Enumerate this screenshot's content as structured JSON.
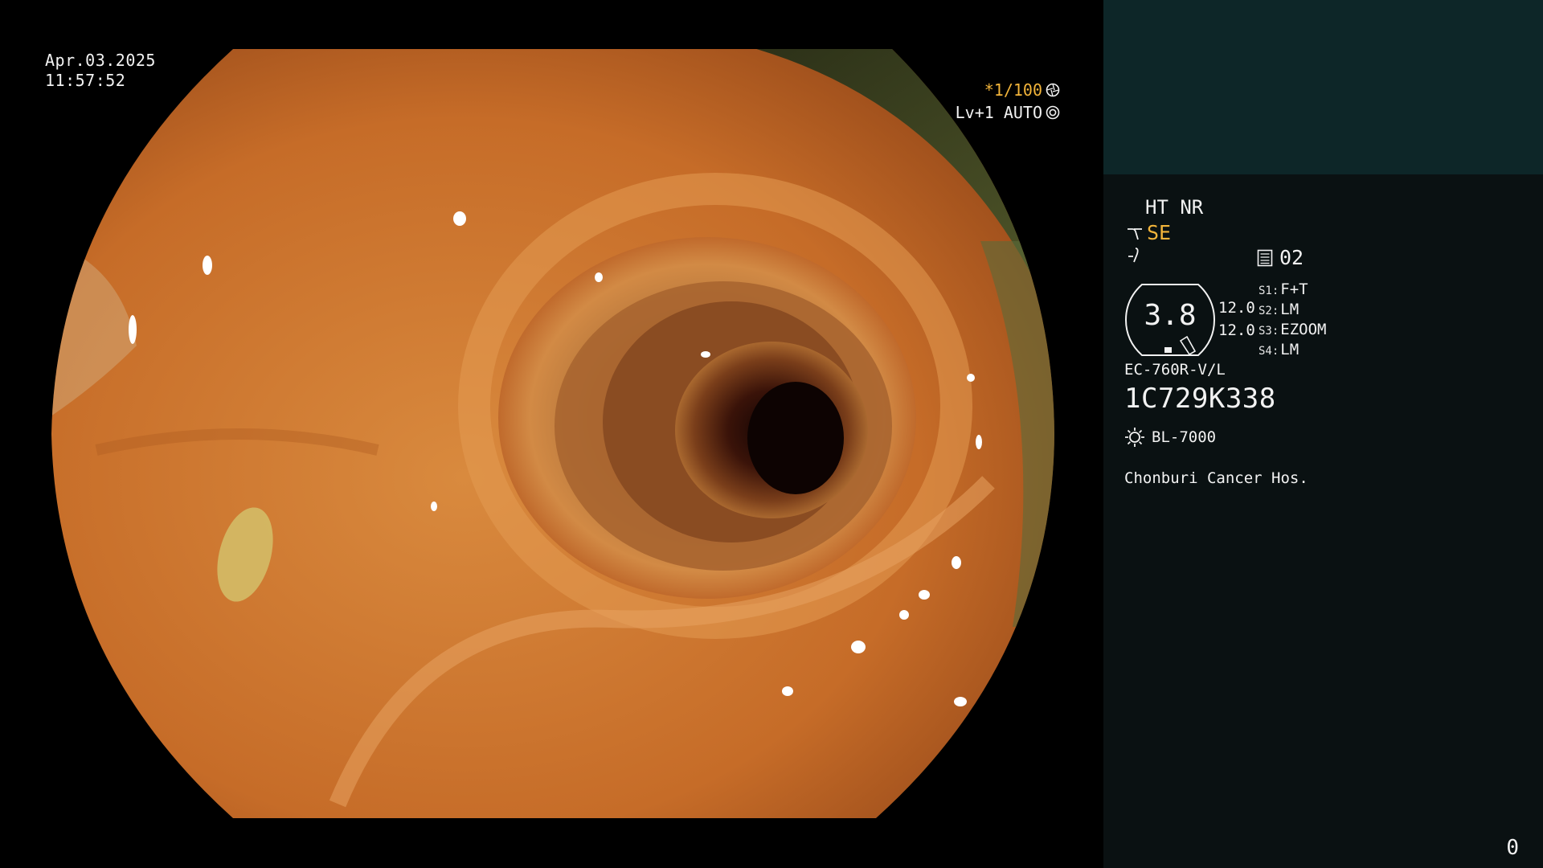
{
  "overlay": {
    "date": "Apr.03.2025",
    "time": "11:57:52",
    "shutter": "*1/100",
    "shutter_icon": "shutter-icon",
    "exposure": "Lv+1 AUTO",
    "exposure_icon": "iris-icon"
  },
  "panel": {
    "ht_nr": "HT NR",
    "structure_enhancement": "SE",
    "memory_label": "02",
    "gauge_value": "3.8",
    "iris_values": [
      "12.0",
      "12.0"
    ],
    "switches": [
      {
        "key": "S1:",
        "value": "F+T"
      },
      {
        "key": "S2:",
        "value": "LM"
      },
      {
        "key": "S3:",
        "value": "EZOOM"
      },
      {
        "key": "S4:",
        "value": "LM"
      }
    ],
    "scope_model": "EC-760R-V/L",
    "scope_serial": "1C729K338",
    "light_source": "BL-7000",
    "hospital": "Chonburi Cancer Hos.",
    "counter": "0"
  },
  "colors": {
    "accent_orange": "#f2b43a",
    "panel_bg": "#0a1112",
    "panel_top_bg": "#0d2628",
    "mucosa": "#c96f2c",
    "lumen": "#2a0c06"
  }
}
